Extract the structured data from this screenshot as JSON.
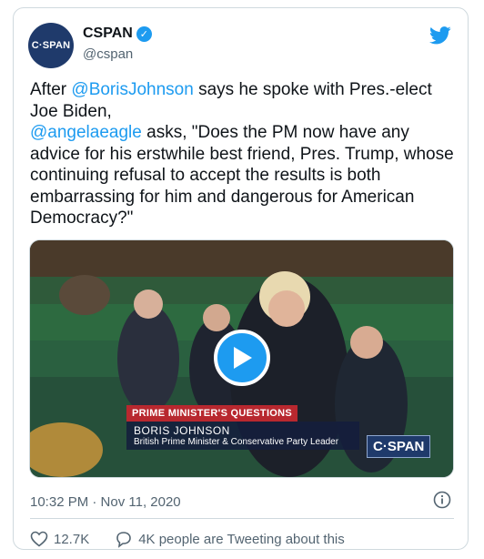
{
  "author": {
    "avatar_text": "C·SPAN",
    "display_name": "CSPAN",
    "handle": "@cspan",
    "verified": true
  },
  "tweet": {
    "parts": [
      {
        "text": "After ",
        "mention": false
      },
      {
        "text": "@BorisJohnson",
        "mention": true
      },
      {
        "text": " says he spoke with Pres.-elect Joe Biden,\n",
        "mention": false
      },
      {
        "text": "@angelaeagle",
        "mention": true
      },
      {
        "text": " asks, \"Does the PM now have any advice for his erstwhile best friend, Pres. Trump, whose continuing refusal to accept the results is both embarrassing for him and dangerous for American Democracy?\"",
        "mention": false
      }
    ]
  },
  "media": {
    "lower_third_title": "PRIME MINISTER'S QUESTIONS",
    "lower_third_name": "BORIS JOHNSON",
    "lower_third_subtitle": "British Prime Minister & Conservative Party Leader",
    "channel_logo": "C·SPAN"
  },
  "timestamp": "10:32 PM · Nov 11, 2020",
  "actions": {
    "like_count": "12.7K",
    "tweeting_about": "4K people are Tweeting about this"
  },
  "colors": {
    "accent": "#1d9bf0",
    "text": "#0f1419",
    "secondary": "#536471",
    "lower_third_red": "#b8282f",
    "cspan_blue": "#1f3a6b"
  }
}
